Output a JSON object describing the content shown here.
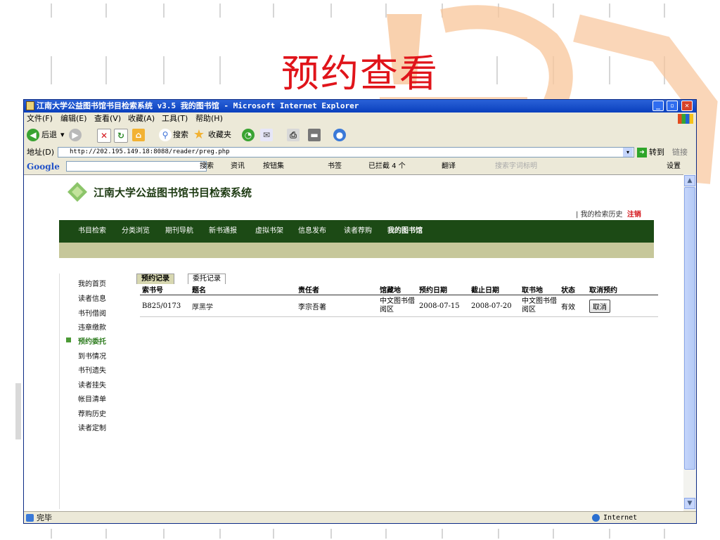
{
  "slide": {
    "title": "预约查看"
  },
  "window": {
    "title": "江南大学公益图书馆书目检索系统 v3.5 我的图书馆 - Microsoft Internet Explorer",
    "controls": {
      "minimize": "_",
      "maximize": "▫",
      "close": "✕"
    }
  },
  "menubar": {
    "items": [
      "文件(F)",
      "编辑(E)",
      "查看(V)",
      "收藏(A)",
      "工具(T)",
      "帮助(H)"
    ]
  },
  "toolbar": {
    "back": "后退",
    "search": "搜索",
    "favorites": "收藏夹"
  },
  "addressbar": {
    "label": "地址(D)",
    "url": "http://202.195.149.18:8088/reader/preg.php",
    "go": "转到",
    "links": "链接"
  },
  "googlebar": {
    "brand": "Google",
    "search": "搜索",
    "news": "资讯",
    "buttons": "按钮集",
    "bookmarks": "书签",
    "blocked": "已拦截 4 个",
    "translate": "翻译",
    "spell": "搜索字词标明",
    "settings": "设置"
  },
  "site": {
    "name": "江南大学公益图书馆书目检索系统",
    "history_link": "我的检索历史",
    "logout": "注销",
    "nav": [
      "书目检索",
      "分类浏览",
      "期刊导航",
      "新书通报",
      "虚拟书架",
      "信息发布",
      "读者荐购",
      "我的图书馆"
    ],
    "sidebar": [
      "我的首页",
      "读者信息",
      "书刊借阅",
      "违章缴款",
      "预约委托",
      "到书情况",
      "书刊遗失",
      "读者挂失",
      "帐目清单",
      "荐购历史",
      "读者定制"
    ],
    "tabs": [
      "预约记录",
      "委托记录"
    ],
    "table": {
      "headers": [
        "索书号",
        "题名",
        "责任者",
        "馆藏地",
        "预约日期",
        "截止日期",
        "取书地",
        "状态",
        "取消预约"
      ],
      "rows": [
        {
          "call_no": "B825/0173",
          "title": "厚黑学",
          "author": "李宗吾著",
          "location": "中文图书借阅区",
          "reserve_date": "2008-07-15",
          "due_date": "2008-07-20",
          "pickup": "中文图书借阅区",
          "status": "有效",
          "action": "取消"
        }
      ]
    }
  },
  "statusbar": {
    "status": "完毕",
    "zone": "Internet"
  },
  "colors": {
    "slide_title": "#e0141a",
    "nav_bg": "#1c4a15",
    "subnav_bg": "#c6c79a",
    "logout": "#d4141a"
  }
}
